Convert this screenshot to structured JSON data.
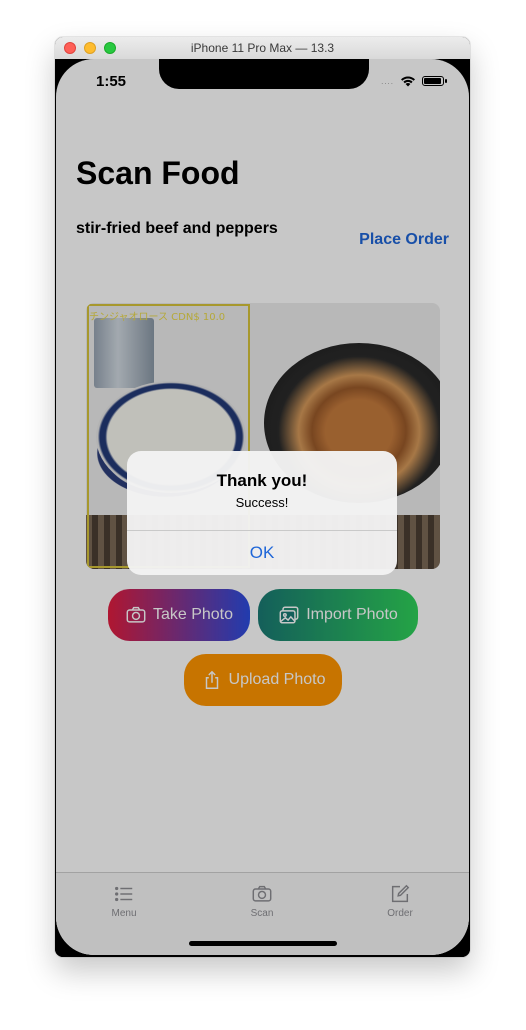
{
  "window": {
    "title": "iPhone 11 Pro Max — 13.3"
  },
  "status_bar": {
    "time": "1:55",
    "signal": "....",
    "icons": [
      "wifi-icon",
      "battery-icon"
    ]
  },
  "page": {
    "title": "Scan Food",
    "dish_name": "stir-fried beef and peppers",
    "place_order_label": "Place Order"
  },
  "photo": {
    "detection_label": "チンジャオロース  CDN$ 10.0"
  },
  "buttons": {
    "take_photo": "Take Photo",
    "import_photo": "Import Photo",
    "upload_photo": "Upload Photo"
  },
  "alert": {
    "title": "Thank you!",
    "message": "Success!",
    "ok_label": "OK"
  },
  "tabs": [
    {
      "label": "Menu",
      "icon": "list-icon"
    },
    {
      "label": "Scan",
      "icon": "camera-icon"
    },
    {
      "label": "Order",
      "icon": "compose-icon"
    }
  ],
  "colors": {
    "accent": "#1f66d8",
    "take_photo_gradient": [
      "#e11d3f",
      "#2b4de0"
    ],
    "import_photo_gradient": [
      "#1a7a74",
      "#2fd25a"
    ],
    "upload_photo": "#ff9500",
    "detection_box": "#d7c33a"
  }
}
